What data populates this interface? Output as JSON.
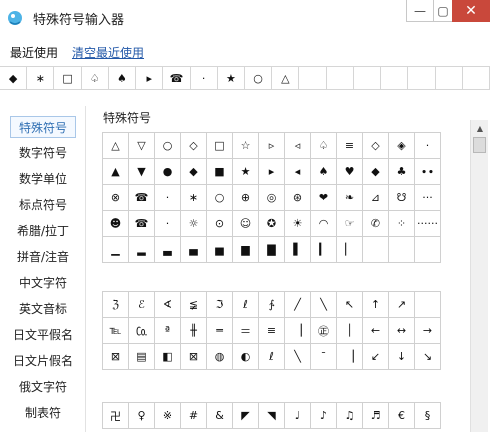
{
  "window": {
    "title": "特殊符号输入器",
    "min_label": "—",
    "max_label": "▢",
    "close_label": "✕"
  },
  "recent": {
    "label": "最近使用",
    "clear_label": "清空最近使用",
    "items": [
      "◆",
      "∗",
      "□",
      "♤",
      "♠",
      "▸",
      "☎",
      "·",
      "★",
      "○",
      "△",
      "",
      "",
      "",
      "",
      "",
      "",
      ""
    ]
  },
  "sidebar": {
    "items": [
      {
        "label": "特殊符号"
      },
      {
        "label": "数字符号"
      },
      {
        "label": "数学单位"
      },
      {
        "label": "标点符号"
      },
      {
        "label": "希腊/拉丁"
      },
      {
        "label": "拼音/注音"
      },
      {
        "label": "中文字符"
      },
      {
        "label": "英文音标"
      },
      {
        "label": "日文平假名"
      },
      {
        "label": "日文片假名"
      },
      {
        "label": "俄文字符"
      },
      {
        "label": "制表符"
      }
    ]
  },
  "content": {
    "title": "特殊符号",
    "section1": [
      "△",
      "▽",
      "○",
      "◇",
      "□",
      "☆",
      "▹",
      "◃",
      "♤",
      "≡",
      "◇",
      "◈",
      "·",
      "▲",
      "▼",
      "●",
      "◆",
      "■",
      "★",
      "▸",
      "◂",
      "♠",
      "♥",
      "◆",
      "♣",
      "∙∙",
      "⊗",
      "☎",
      "·",
      "∗",
      "○",
      "⊕",
      "◎",
      "⊛",
      "❤",
      "❧",
      "⊿",
      "☋",
      "···",
      "☻",
      "☎",
      "·",
      "☼",
      "⊙",
      "☺",
      "✪",
      "☀",
      "◠",
      "☞",
      "✆",
      "⁘",
      "······",
      "▁",
      "▂",
      "▃",
      "▄",
      "▅",
      "▆",
      "▇",
      "▌",
      "▎",
      "▏",
      "",
      "",
      ""
    ],
    "section2": [
      "ℨ",
      "ℰ",
      "∢",
      "≨",
      "ℑ",
      "ℓ",
      "∱",
      "╱",
      "╲",
      "↖",
      "↑",
      "↗",
      "",
      "℡",
      "㏇",
      "ª",
      "╫",
      "═",
      "＝",
      "≡",
      "▕",
      "㊣",
      "│",
      "←",
      "↔",
      "→",
      "⊠",
      "▤",
      "◧",
      "⊠",
      "◍",
      "◐",
      "ℓ",
      "╲",
      "¯",
      "▕",
      "↙",
      "↓",
      "↘"
    ],
    "section3": [
      "卍",
      "♀",
      "※",
      "#",
      "&",
      "◤",
      "◥",
      "♩",
      "♪",
      "♫",
      "♬",
      "€",
      "§"
    ]
  }
}
